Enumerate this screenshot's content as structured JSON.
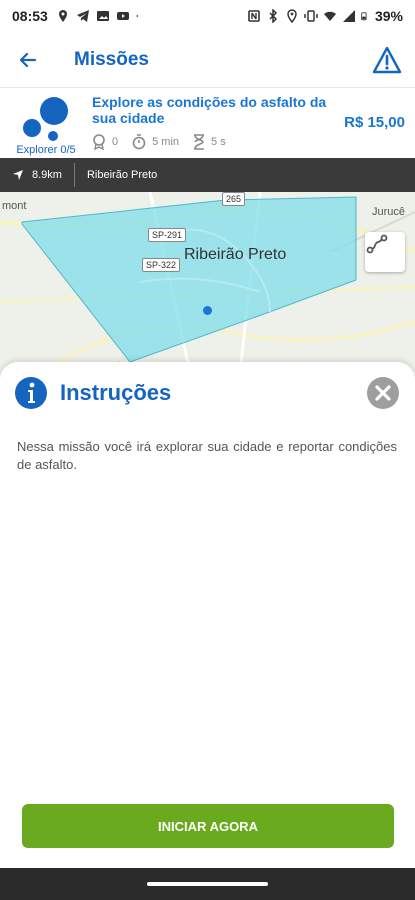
{
  "status_bar": {
    "time": "08:53",
    "battery": "39%",
    "left_icons": [
      "maps-pin-icon",
      "telegram-icon",
      "gallery-icon",
      "youtube-icon",
      "dot-icon"
    ],
    "right_icons": [
      "nfc-icon",
      "bluetooth-icon",
      "location-icon",
      "vibrate-icon",
      "wifi-icon",
      "signal-icon",
      "battery-icon"
    ]
  },
  "header": {
    "title": "Missões",
    "back_icon": "arrow-left-icon",
    "warning_icon": "warning-triangle-icon"
  },
  "mission": {
    "title": "Explore as condições do asfalto da sua cidade",
    "price": "R$ 15,00",
    "explorer_label": "Explorer 0/5",
    "stats": {
      "badge": "0",
      "duration": "5 min",
      "time_limit": "5 s"
    }
  },
  "location": {
    "distance": "8.9km",
    "city": "Ribeirão Preto"
  },
  "map": {
    "labels": {
      "west": "mont",
      "east": "Jurucê",
      "city": "Ribeirão Preto",
      "road_1": "SP-291",
      "road_2": "SP-322",
      "road_3": "265"
    }
  },
  "instructions": {
    "title": "Instruções",
    "text": "Nessa missão você irá explorar sua cidade e reportar condições de asfalto.",
    "cta": "INICIAR AGORA"
  },
  "colors": {
    "primary": "#1565c0",
    "accent": "#1976d2",
    "cta": "#6aaa1e",
    "area_fill": "#80deea"
  }
}
